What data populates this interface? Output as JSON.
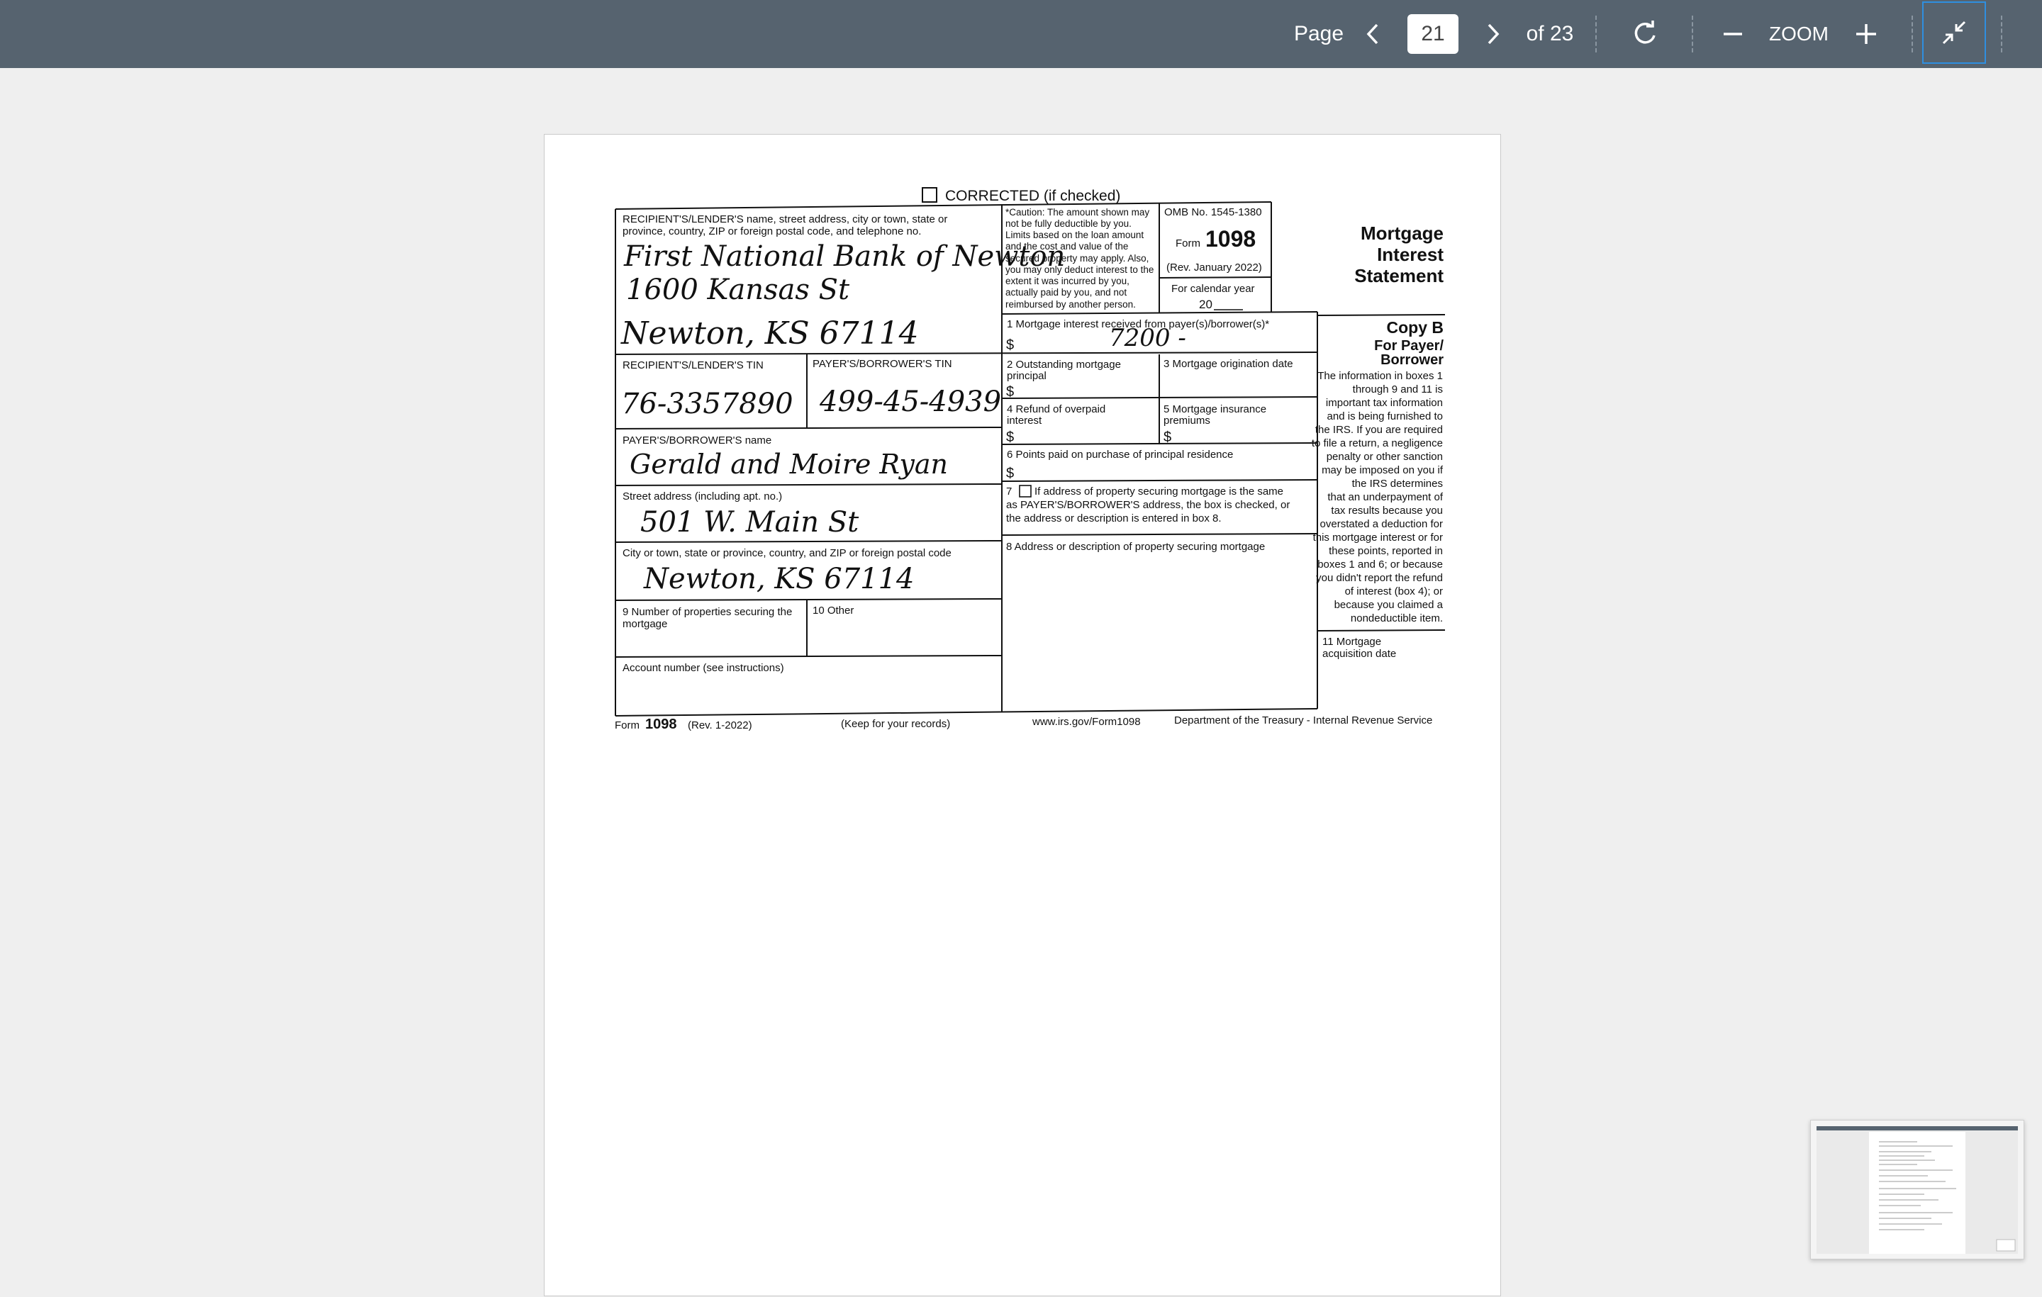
{
  "toolbar": {
    "page_label": "Page",
    "current_page": "21",
    "of_label": "of 23",
    "zoom_label": "ZOOM",
    "icons": [
      "chevron-left-icon",
      "chevron-right-icon",
      "rotate-icon",
      "zoom-out-icon",
      "zoom-in-icon",
      "exit-fullscreen-icon"
    ]
  },
  "form": {
    "corrected": "CORRECTED (if checked)",
    "recipient_label_1": "RECIPIENT'S/LENDER'S name, street address, city or town, state or",
    "recipient_label_2": "province, country, ZIP or foreign postal code, and telephone no.",
    "recipient_name": "First National Bank of Newton",
    "recipient_street": "1600 Kansas St",
    "recipient_city": "Newton, KS 67114",
    "caution": [
      "*Caution: The amount shown may",
      "not be fully deductible by you.",
      "Limits based on the loan amount",
      "and the cost and value of the",
      "secured property may apply. Also,",
      "you may only deduct interest to the",
      "extent it was incurred by you,",
      "actually paid by you, and not",
      "reimbursed by another person."
    ],
    "omb": "OMB No. 1545-1380",
    "form_word": "Form",
    "form_number": "1098",
    "rev": "(Rev. January 2022)",
    "calendar_year": "For calendar year",
    "year_prefix": "20",
    "title_1": "Mortgage",
    "title_2": "Interest",
    "title_3": "Statement",
    "box1_label": "1 Mortgage interest received from payer(s)/borrower(s)*",
    "box1_value": "7200 -",
    "dollar": "$",
    "copy_b": "Copy B",
    "for_payer": "For Payer/",
    "borrower": "Borrower",
    "copy_text": [
      "The information in boxes 1",
      "through 9 and 11 is",
      "important tax information",
      "and is being furnished to",
      "the IRS. If you are required",
      "to file a return, a negligence",
      "penalty or other sanction",
      "may be imposed on you if",
      "the IRS determines",
      "that an underpayment of",
      "tax results because you",
      "overstated a deduction for",
      "this mortgage interest or for",
      "these points, reported in",
      "boxes 1 and 6; or because",
      "you didn't report the refund",
      "of interest (box 4); or",
      "because you claimed a",
      "nondeductible item."
    ],
    "recipient_tin_label": "RECIPIENT'S/LENDER'S TIN",
    "payer_tin_label": "PAYER'S/BORROWER'S TIN",
    "recipient_tin": "76-3357890",
    "payer_tin": "499-45-4939",
    "box2_label_1": "2 Outstanding mortgage",
    "box2_label_2": "principal",
    "box3_label": "3 Mortgage origination date",
    "box4_label_1": "4 Refund of overpaid",
    "box4_label_2": "interest",
    "box5_label_1": "5 Mortgage insurance",
    "box5_label_2": "premiums",
    "payer_name_label": "PAYER'S/BORROWER'S name",
    "payer_name": "Gerald and Moire Ryan",
    "box6_label": "6 Points paid on purchase of principal residence",
    "street_label": "Street address (including apt. no.)",
    "street_value": "501 W. Main St",
    "box7_label_1": "If address of property securing mortgage is the same",
    "box7_label_2": "as PAYER'S/BORROWER'S address, the box is checked, or",
    "box7_label_3": "the address or description is entered in box 8.",
    "box7_num": "7",
    "city_label": "City or town, state or province, country, and ZIP or foreign postal code",
    "city_value": "Newton, KS 67114",
    "box8_label": "8 Address or description of property securing mortgage",
    "box9_label_1": "9 Number of properties securing the",
    "box9_label_2": "mortgage",
    "box10_label": "10 Other",
    "box11_label_1": "11 Mortgage",
    "box11_label_2": "acquisition date",
    "account_label": "Account number (see instructions)",
    "footer_form": "Form",
    "footer_number": "1098",
    "footer_rev": "(Rev. 1-2022)",
    "footer_keep": "(Keep for your records)",
    "footer_url": "www.irs.gov/Form1098",
    "footer_dept": "Department of the Treasury - Internal Revenue Service"
  }
}
